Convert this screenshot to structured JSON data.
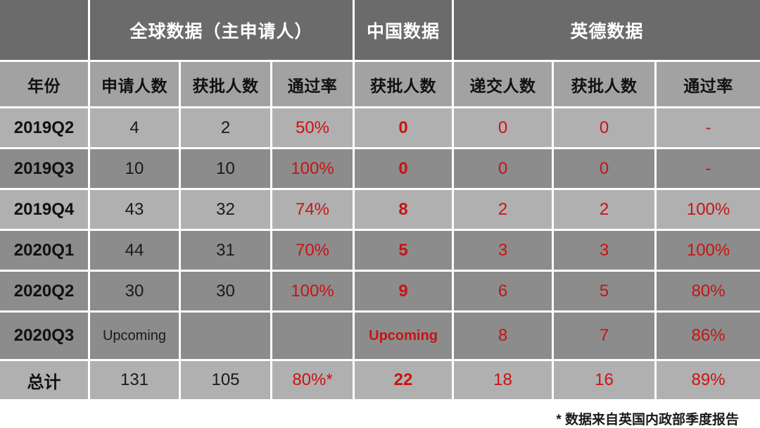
{
  "table": {
    "groups": [
      {
        "label": "",
        "span": 1,
        "blank": true
      },
      {
        "label": "全球数据（主申请人）",
        "span": 3,
        "blank": false
      },
      {
        "label": "中国数据",
        "span": 1,
        "blank": false
      },
      {
        "label": "英德数据",
        "span": 3,
        "blank": false
      }
    ],
    "columns": [
      "年份",
      "申请人数",
      "获批人数",
      "通过率",
      "获批人数",
      "递交人数",
      "获批人数",
      "通过率"
    ],
    "rows": [
      {
        "shade": "light",
        "period": "2019Q2",
        "global_applicants": "4",
        "global_approved": "2",
        "global_rate": "50%",
        "china_approved": "0",
        "ukde_submitted": "0",
        "ukde_approved": "0",
        "ukde_rate": "-"
      },
      {
        "shade": "dark",
        "period": "2019Q3",
        "global_applicants": "10",
        "global_approved": "10",
        "global_rate": "100%",
        "china_approved": "0",
        "ukde_submitted": "0",
        "ukde_approved": "0",
        "ukde_rate": "-"
      },
      {
        "shade": "light",
        "period": "2019Q4",
        "global_applicants": "43",
        "global_approved": "32",
        "global_rate": "74%",
        "china_approved": "8",
        "ukde_submitted": "2",
        "ukde_approved": "2",
        "ukde_rate": "100%"
      },
      {
        "shade": "dark",
        "period": "2020Q1",
        "global_applicants": "44",
        "global_approved": "31",
        "global_rate": "70%",
        "china_approved": "5",
        "ukde_submitted": "3",
        "ukde_approved": "3",
        "ukde_rate": "100%"
      },
      {
        "shade": "dark",
        "period": "2020Q2",
        "global_applicants": "30",
        "global_approved": "30",
        "global_rate": "100%",
        "china_approved": "9",
        "ukde_submitted": "6",
        "ukde_approved": "5",
        "ukde_rate": "80%"
      },
      {
        "shade": "dark",
        "period": "2020Q3",
        "global_applicants": "Upcoming",
        "global_approved": "",
        "global_rate": "",
        "china_approved": "Upcoming",
        "ukde_submitted": "8",
        "ukde_approved": "7",
        "ukde_rate": "86%"
      },
      {
        "shade": "light",
        "period": "总计",
        "global_applicants": "131",
        "global_approved": "105",
        "global_rate": "80%*",
        "china_approved": "22",
        "ukde_submitted": "18",
        "ukde_approved": "16",
        "ukde_rate": "89%"
      }
    ]
  },
  "footnote": "* 数据来自英国内政部季度报告",
  "colors": {
    "group_header_bg": "#6b6b6b",
    "header_bg": "#a2a2a2",
    "row_light_bg": "#b0b0b0",
    "row_dark_bg": "#8c8c8c",
    "accent_red": "#c81414",
    "grid_line": "#ffffff",
    "page_bg": "#ffffff"
  }
}
